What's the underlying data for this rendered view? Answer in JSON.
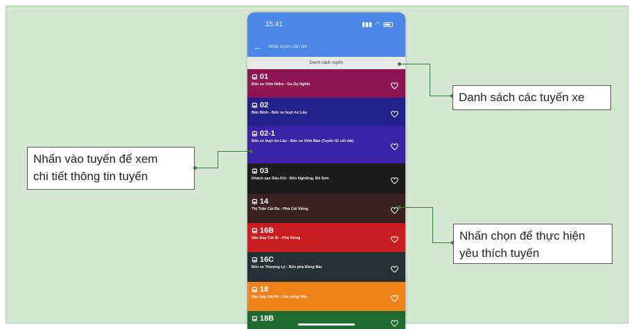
{
  "status_bar": {
    "time": "15:41",
    "signal": "∶∶∶",
    "wifi": "▾"
  },
  "search": {
    "placeholder": "Nhập tuyến cần tìm",
    "back_icon": "arrow-left-icon"
  },
  "list_header": "Danh sách tuyến",
  "routes": [
    {
      "code": "01",
      "desc": "Bến xe Vĩnh Niệm - Ga Dụ Nghĩa",
      "color": "#8e1452"
    },
    {
      "code": "02",
      "desc": "Bến Bính - Bến xe buýt An Lão",
      "color": "#24208a"
    },
    {
      "code": "02-1",
      "desc": "Bến xe buýt An Lão - Bến xe Vĩnh Bảo (Tuyến 02 nối dài)",
      "color": "#3b21a6"
    },
    {
      "code": "03",
      "desc": "Khách sạn Dầu Khí - Bến Nghiêng, Đồ Sơn",
      "color": "#1c1c1c"
    },
    {
      "code": "14",
      "desc": "Thị Trấn Cát Bà - Phà Cái Viềng",
      "color": "#3b2220"
    },
    {
      "code": "16B",
      "desc": "Sân Bay Cát Bi - Phà Rừng",
      "color": "#c91d20"
    },
    {
      "code": "16C",
      "desc": "Bến xe Thượng Lý - Bến phà Đồng Bài",
      "color": "#243034"
    },
    {
      "code": "18",
      "desc": "Sân bay Cát Bi - Cầu sông Hóa",
      "color": "#f0821c"
    },
    {
      "code": "18B",
      "desc": "",
      "color": "#1f6b30"
    }
  ],
  "callouts": {
    "list": "Danh sách các tuyến xe",
    "tap_route_line1": "Nhấn vào tuyến để xem",
    "tap_route_line2": "chi tiết thông tin tuyến",
    "favorite_line1": "Nhấn chọn để thực hiện",
    "favorite_line2": "yêu thích tuyến"
  },
  "colors": {
    "app_bar": "#4a86e8",
    "background": "#d5e8d4",
    "connector": "#3a7a3a"
  }
}
